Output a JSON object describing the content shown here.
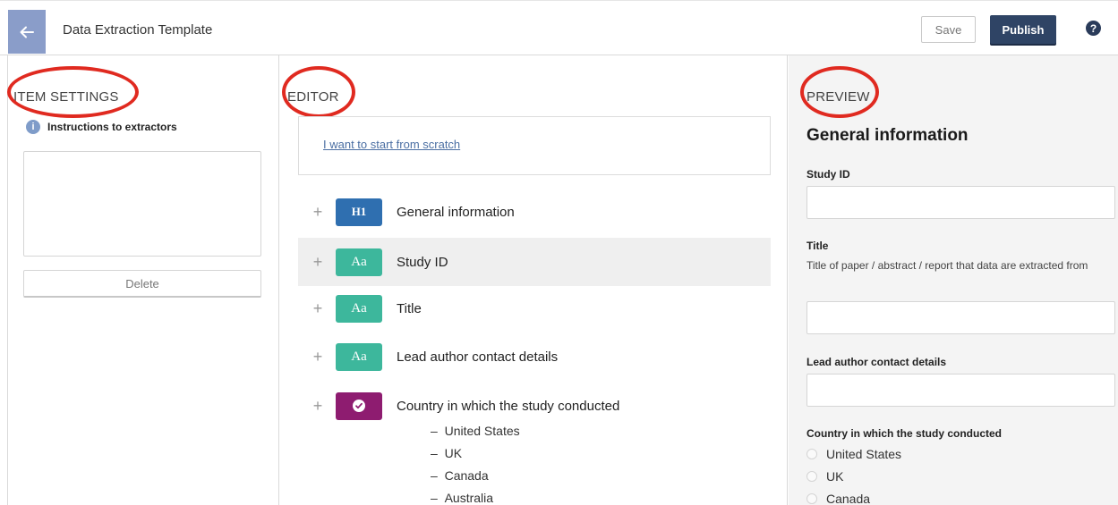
{
  "app": {
    "title": "Data Extraction Template"
  },
  "toolbar": {
    "save_label": "Save",
    "publish_label": "Publish",
    "help_glyph": "?"
  },
  "settings": {
    "heading": "ITEM SETTINGS",
    "instructions_label": "Instructions to extractors",
    "info_glyph": "i",
    "delete_label": "Delete"
  },
  "editor": {
    "heading": "EDITOR",
    "scratch_link": "I want to start from scratch",
    "fields": [
      {
        "type": "heading",
        "badge": "H1",
        "label": "General information"
      },
      {
        "type": "text",
        "badge": "Aa",
        "label": "Study ID"
      },
      {
        "type": "text",
        "badge": "Aa",
        "label": "Title"
      },
      {
        "type": "text",
        "badge": "Aa",
        "label": "Lead author contact details"
      },
      {
        "type": "choice",
        "badge": "check-icon",
        "label": "Country in which the study conducted"
      }
    ],
    "options": [
      "United States",
      "UK",
      "Canada",
      "Australia"
    ],
    "option_prefix": "–"
  },
  "preview": {
    "heading": "PREVIEW",
    "section_title": "General information",
    "study_id_label": "Study ID",
    "title_label": "Title",
    "title_help": "Title of paper / abstract / report that data are extracted from",
    "lead_author_label": "Lead author contact details",
    "country_label": "Country in which the study conducted",
    "country_options": [
      "United States",
      "UK",
      "Canada"
    ]
  },
  "colors": {
    "accent_navy": "#2f4465",
    "heading_badge": "#2f6fb0",
    "text_badge": "#3db79c",
    "choice_badge": "#8e1c70",
    "annotation_red": "#e02a20"
  }
}
